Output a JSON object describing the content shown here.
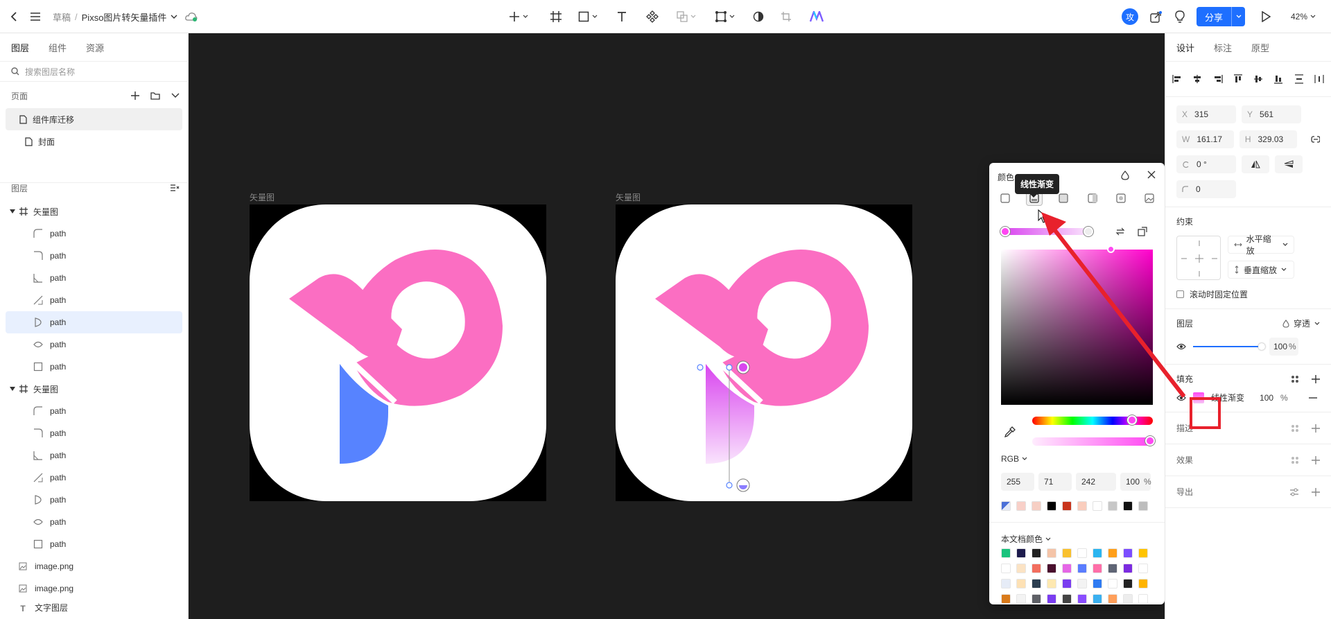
{
  "toolbar": {
    "breadcrumb_root": "草稿",
    "breadcrumb_sep": "/",
    "file_name": "Pixso图片转矢量插件",
    "avatar_text": "攻",
    "share_label": "分享",
    "zoom": "42%"
  },
  "left": {
    "tabs": [
      "图层",
      "组件",
      "资源"
    ],
    "search_placeholder": "搜索图层名称",
    "pages_title": "页面",
    "pages": [
      "组件库迁移",
      "封面"
    ],
    "layers_title": "图层",
    "group1": {
      "name": "矢量图",
      "children": [
        "path",
        "path",
        "path",
        "path",
        "path",
        "path",
        "path"
      ]
    },
    "group2": {
      "name": "矢量图",
      "children": [
        "path",
        "path",
        "path",
        "path",
        "path",
        "path",
        "path"
      ]
    },
    "images": [
      "image.png",
      "image.png"
    ],
    "truncated_item": "文字图层"
  },
  "canvas": {
    "frame1_label": "矢量图",
    "frame2_label": "矢量图"
  },
  "color_popup": {
    "title": "颜色",
    "tooltip": "线性渐变",
    "mode": "RGB",
    "r": "255",
    "g": "71",
    "b": "242",
    "a": "100",
    "pct": "%",
    "doc_colors_title": "本文档颜色"
  },
  "right": {
    "tabs": [
      "设计",
      "标注",
      "原型"
    ],
    "x_label": "X",
    "x": "315",
    "y_label": "Y",
    "y": "561",
    "w_label": "W",
    "w": "161.17",
    "h_label": "H",
    "h": "329.03",
    "rotation": "0 °",
    "radius": "0",
    "constraints_title": "约束",
    "h_constraint": "水平缩放",
    "v_constraint": "垂直缩放",
    "fix_on_scroll": "滚动时固定位置",
    "layer_title": "图层",
    "blend": "穿透",
    "opacity": "100",
    "opacity_unit": "%",
    "fill_title": "填充",
    "fill_type": "线性渐变",
    "fill_opacity": "100",
    "fill_unit": "%",
    "stroke_title": "描边",
    "effect_title": "效果",
    "export_title": "导出"
  },
  "colors": {
    "accent": "#1e6fff",
    "pink": "#fb6ec2",
    "blue": "#5783ff",
    "gradient_top": "#d946ef"
  }
}
